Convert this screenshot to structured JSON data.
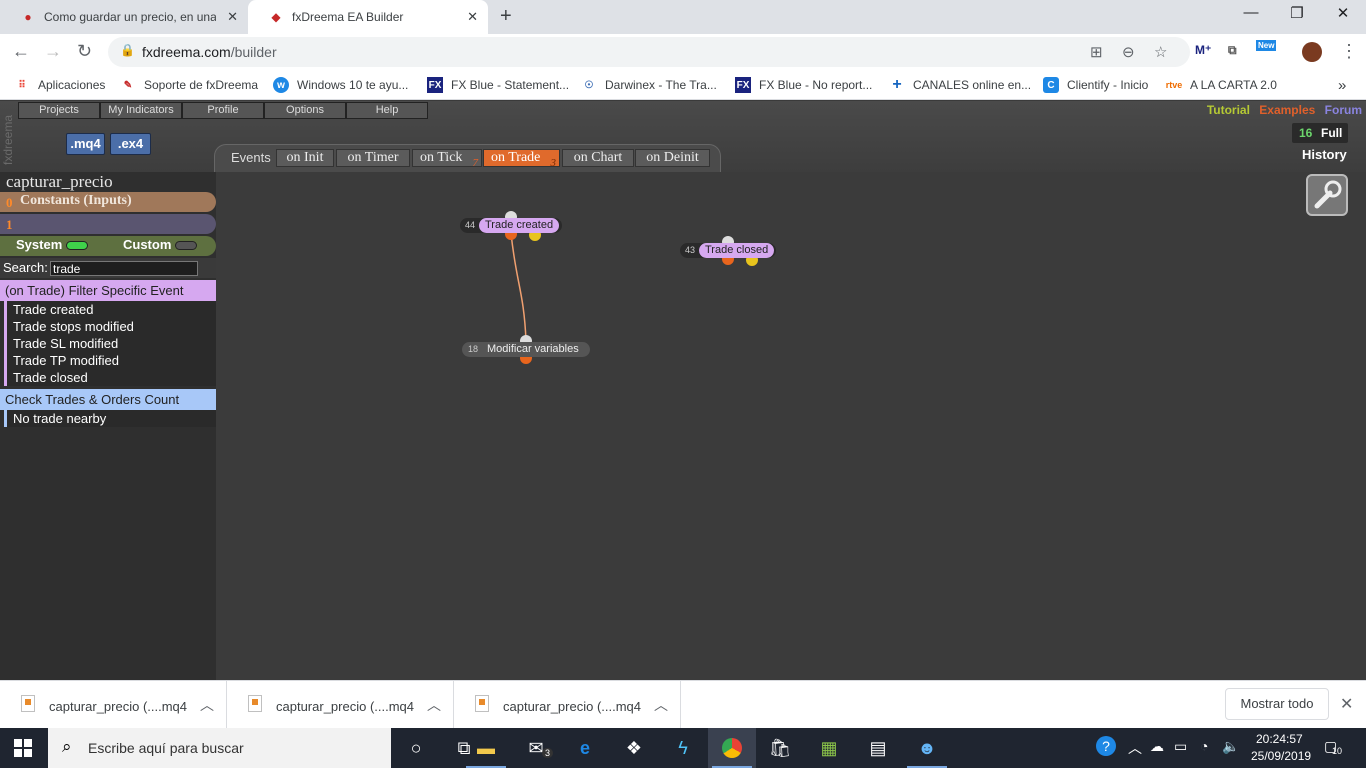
{
  "browser": {
    "tabs": [
      {
        "title": "Como guardar un precio, en una",
        "close": "✕"
      },
      {
        "title": "fxDreema EA Builder",
        "close": "✕"
      }
    ],
    "new_tab": "+",
    "window_controls": {
      "minimize": "—",
      "maximize": "❐",
      "close": "✕"
    },
    "url_host": "fxdreema.com",
    "url_path": "/builder",
    "bookmarks": [
      {
        "label": "Aplicaciones",
        "icon": "apps-grid-icon",
        "color": "#ea4335"
      },
      {
        "label": "Soporte de fxDreema",
        "icon": "fxdreema-icon",
        "color": "#c62828"
      },
      {
        "label": "Windows 10 te ayu...",
        "icon": "windows-help-icon",
        "color": "#1e88e5"
      },
      {
        "label": "FX Blue - Statement...",
        "icon": "fxblue-icon",
        "color": "#1a237e"
      },
      {
        "label": "Darwinex - The Tra...",
        "icon": "darwinex-icon",
        "color": "#3f6fb5"
      },
      {
        "label": "FX Blue - No report...",
        "icon": "fxblue-icon",
        "color": "#1a237e"
      },
      {
        "label": "CANALES online en...",
        "icon": "plus-icon",
        "color": "#1565c0"
      },
      {
        "label": "Clientify - Inicio",
        "icon": "clientify-icon",
        "color": "#1e88e5"
      },
      {
        "label": "A LA CARTA 2.0",
        "icon": "rtve-icon",
        "color": "#ef6c00"
      }
    ],
    "bookmarks_more": "»",
    "ext_new_badge": "New"
  },
  "app": {
    "brand_vertical": "fxdreema",
    "menu": [
      "Projects",
      "My Indicators",
      "Profile",
      "Options",
      "Help"
    ],
    "format_buttons": [
      ".mq4",
      ".ex4"
    ],
    "links": {
      "tutorial": "Tutorial",
      "examples": "Examples",
      "forum": "Forum"
    },
    "links_colors": {
      "tutorial": "#b5c934",
      "examples": "#e0602b",
      "forum": "#8a84e0"
    },
    "history": {
      "count": "16",
      "full": "Full",
      "label": "History"
    },
    "events": {
      "label": "Events",
      "tabs": [
        {
          "label": "on Init",
          "badge": ""
        },
        {
          "label": "on Timer",
          "badge": ""
        },
        {
          "label": "on Tick",
          "badge": "7"
        },
        {
          "label": "on Trade",
          "badge": "3",
          "active": true
        },
        {
          "label": "on Chart",
          "badge": ""
        },
        {
          "label": "on Deinit",
          "badge": ""
        }
      ]
    },
    "project_name": "capturar_precio",
    "constants": {
      "count": "0",
      "label": "Constants (Inputs)"
    },
    "variables": {
      "count": "1"
    },
    "filters": {
      "system": "System",
      "custom": "Custom",
      "system_on": true,
      "custom_on": false
    },
    "search": {
      "label": "Search:",
      "value": "trade"
    },
    "groups": [
      {
        "title": "(on Trade) Filter Specific Event",
        "color": "#d6a8f0",
        "items": [
          "Trade created",
          "Trade stops modified",
          "Trade SL modified",
          "Trade TP modified",
          "Trade closed"
        ]
      },
      {
        "title": "Check Trades & Orders Count",
        "color": "#a8c8f8",
        "items": [
          "No trade nearby"
        ]
      }
    ],
    "canvas_nodes": [
      {
        "id": "44",
        "label": "Trade created"
      },
      {
        "id": "43",
        "label": "Trade closed"
      },
      {
        "id": "18",
        "label": "Modificar variables"
      }
    ]
  },
  "downloads": {
    "items": [
      "capturar_precio (....mq4",
      "capturar_precio (....mq4",
      "capturar_precio (....mq4"
    ],
    "show_all": "Mostrar todo"
  },
  "taskbar": {
    "search_placeholder": "Escribe aquí para buscar",
    "mail_badge": "3",
    "time": "20:24:57",
    "date": "25/09/2019",
    "notifications": "10"
  }
}
